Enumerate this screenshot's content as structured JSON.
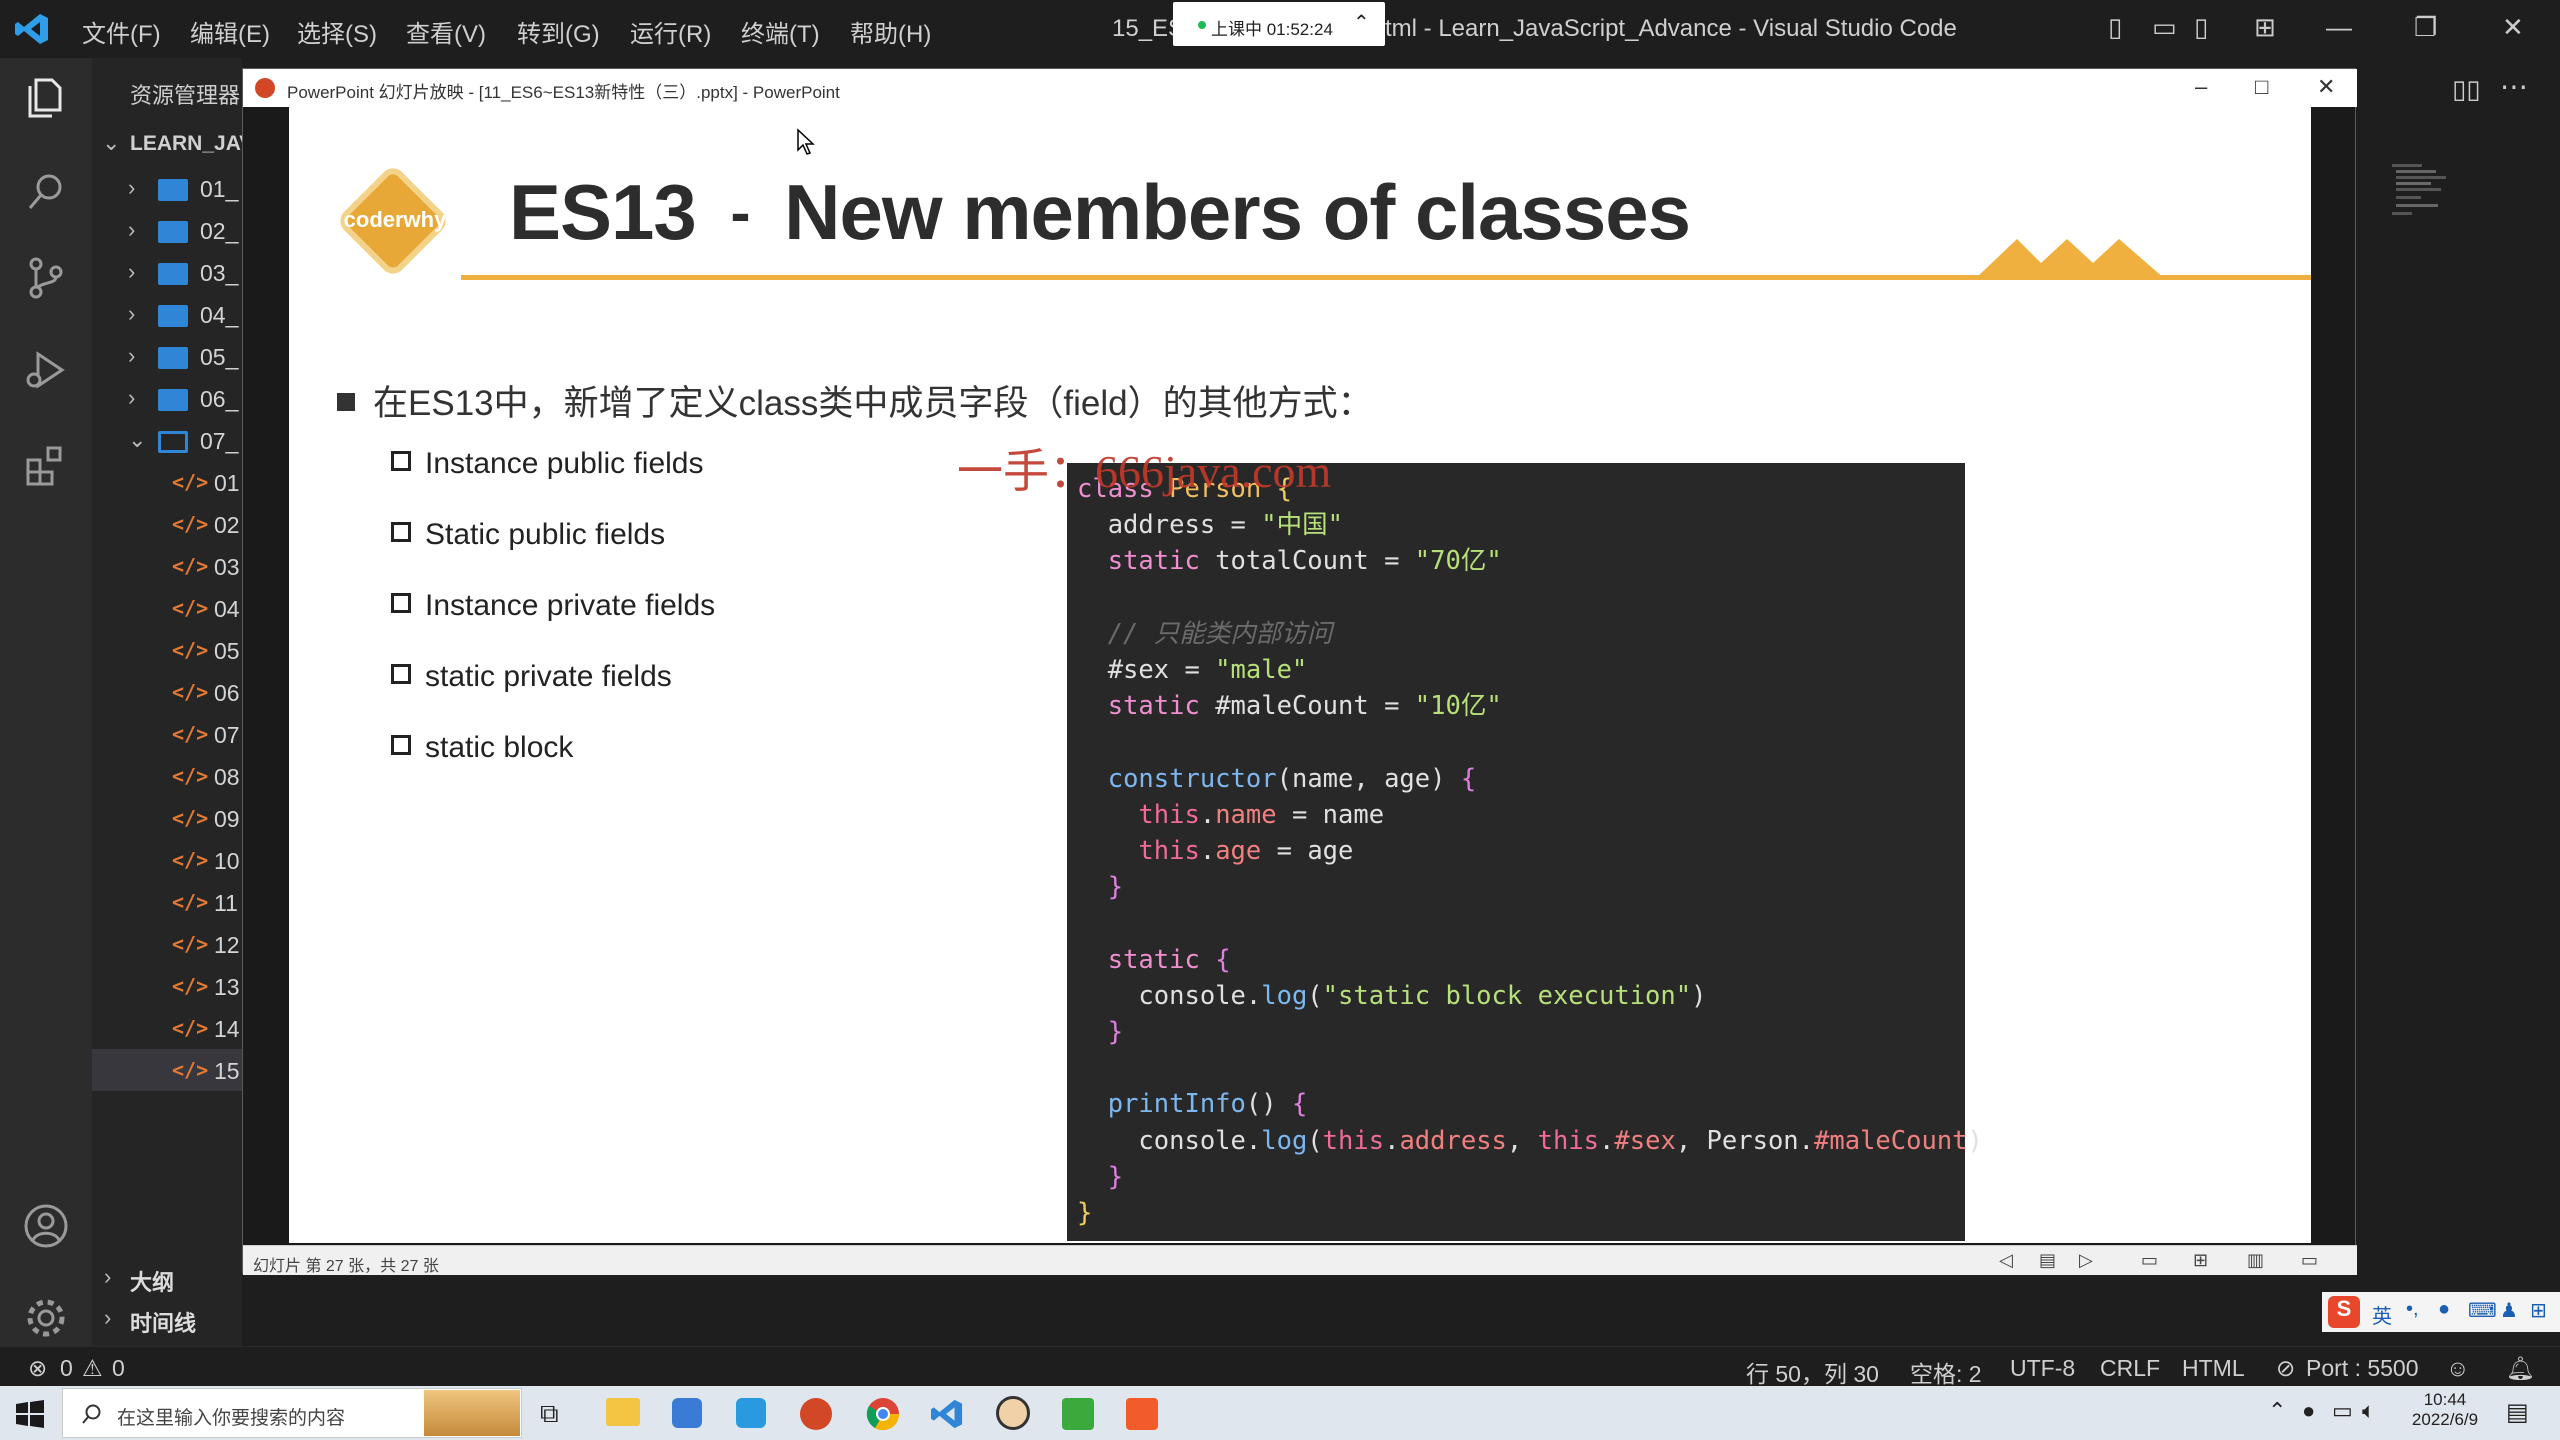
{
  "vscode": {
    "menu": [
      "文件(F)",
      "编辑(E)",
      "选择(S)",
      "查看(V)",
      "转到(G)",
      "运行(R)",
      "终端(T)",
      "帮助(H)"
    ],
    "window_title_left": "15_ES",
    "window_title_right": "tml - Learn_JavaScript_Advance - Visual Studio Code",
    "class_badge": "上课中 01:52:24",
    "explorer_header": "资源管理器",
    "project": "LEARN_JAV",
    "folders": [
      "01_",
      "02_",
      "03_",
      "04_",
      "05_",
      "06_",
      "07_"
    ],
    "files": [
      "01",
      "02",
      "03",
      "04",
      "05",
      "06",
      "07",
      "08",
      "09",
      "10",
      "11",
      "12",
      "13",
      "14",
      "15"
    ],
    "outline": "大纲",
    "timeline": "时间线",
    "status": {
      "problems": "0",
      "warnings": "0",
      "position": "行 50，列 30",
      "spaces": "空格: 2",
      "encoding": "UTF-8",
      "eol": "CRLF",
      "language": "HTML",
      "port": "Port : 5500"
    }
  },
  "powerpoint": {
    "window_title": "PowerPoint 幻灯片放映 - [11_ES6~ES13新特性（三）.pptx] - PowerPoint",
    "status": "幻灯片 第 27 张，共 27 张",
    "slide": {
      "logo_text": "coderwhy",
      "title_a": "ES13",
      "title_sep": "-",
      "title_b": "New members of classes",
      "main_bullet": "在ES13中，新增了定义class类中成员字段（field）的其他方式：",
      "sub_bullets": [
        "Instance public fields",
        "Static public fields",
        "Instance private fields",
        "static private fields",
        "static block"
      ],
      "watermark": "一手：666java.com",
      "code_lines": [
        "class Person {",
        "  address = \"中国\"",
        "  static totalCount = \"70亿\"",
        "",
        "  // 只能类内部访问",
        "  #sex = \"male\"",
        "  static #maleCount = \"10亿\"",
        "",
        "  constructor(name, age) {",
        "    this.name = name",
        "    this.age = age",
        "  }",
        "",
        "  static {",
        "    console.log(\"static block execution\")",
        "  }",
        "",
        "  printInfo() {",
        "    console.log(this.address, this.#sex, Person.#maleCount)",
        "  }",
        "}"
      ]
    }
  },
  "taskbar": {
    "search_placeholder": "在这里输入你要搜索的内容",
    "time": "10:44",
    "date": "2022/6/9",
    "ime_lang": "英"
  },
  "colors": {
    "accent_orange": "#f0b040",
    "code_bg": "#282828",
    "vscode_bg": "#1e1e1e"
  }
}
